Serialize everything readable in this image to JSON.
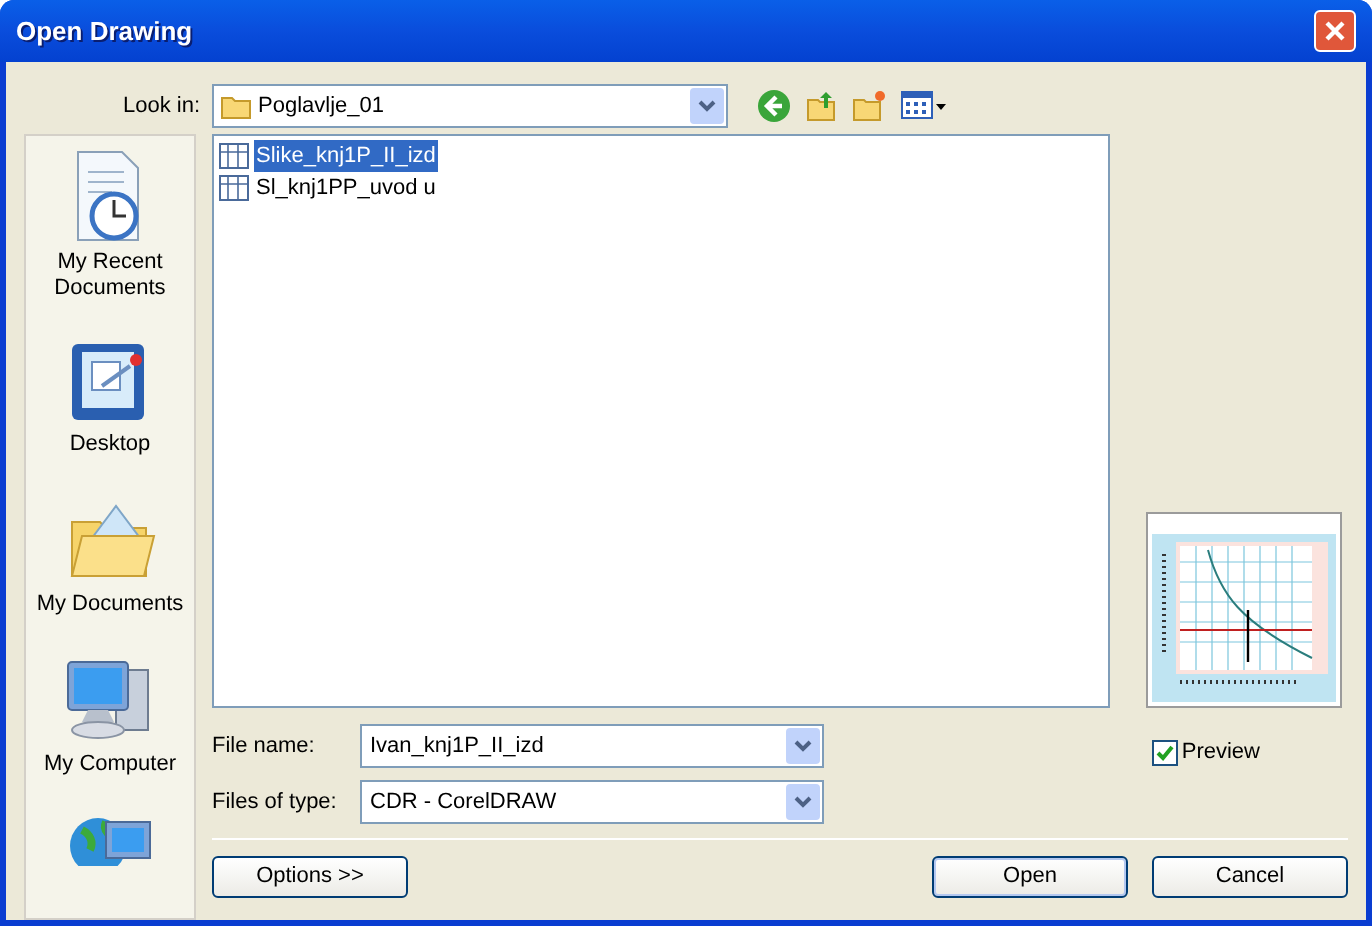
{
  "window": {
    "title": "Open Drawing"
  },
  "look_in": {
    "label": "Look in:",
    "value": "Poglavlje_01"
  },
  "sidebar": {
    "items": [
      {
        "label": "My Recent Documents"
      },
      {
        "label": "Desktop"
      },
      {
        "label": "My Documents"
      },
      {
        "label": "My Computer"
      }
    ]
  },
  "files": [
    {
      "name": "Slike_knj1P_II_izd",
      "selected": true
    },
    {
      "name": "Sl_knj1PP_uvod u",
      "selected": false
    }
  ],
  "file_name": {
    "label": "File name:",
    "value": "Ivan_knj1P_II_izd"
  },
  "file_type": {
    "label": "Files of type:",
    "value": "CDR - CorelDRAW"
  },
  "preview": {
    "label": "Preview",
    "checked": true
  },
  "buttons": {
    "options": "Options >>",
    "open": "Open",
    "cancel": "Cancel"
  }
}
